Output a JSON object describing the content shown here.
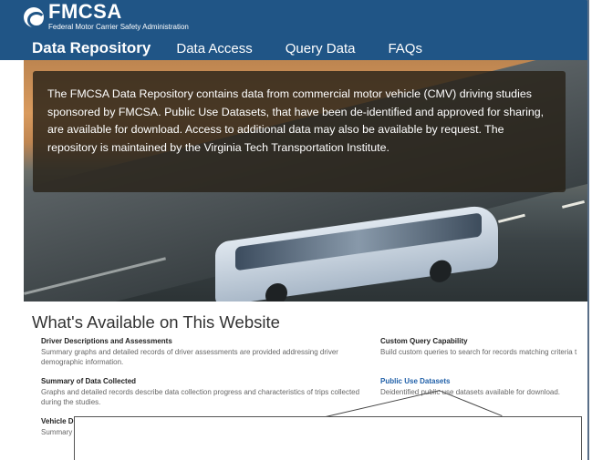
{
  "header": {
    "logo_title": "FMCSA",
    "logo_subtitle": "Federal Motor Carrier Safety Administration",
    "logo_icon": "fmcsa-logo-icon"
  },
  "nav": {
    "items": [
      {
        "label": "Data Repository",
        "active": true
      },
      {
        "label": "Data Access",
        "active": false
      },
      {
        "label": "Query Data",
        "active": false
      },
      {
        "label": "FAQs",
        "active": false
      }
    ]
  },
  "hero": {
    "intro": "The FMCSA Data Repository contains data from commercial motor vehicle (CMV) driving studies sponsored by FMCSA. Public Use Datasets, that have been de-identified and approved for sharing, are available for download. Access to additional data may also be available by request. The repository is maintained by the Virginia Tech Transportation Institute."
  },
  "main": {
    "section_title": "What's Available on This Website",
    "left_features": [
      {
        "title": "Driver Descriptions and Assessments",
        "desc": "Summary graphs and detailed records of driver assessments are provided addressing driver demographic information."
      },
      {
        "title": "Summary of Data Collected",
        "desc": "Graphs and detailed records describe data collection progress and characteristics of trips collected during the studies."
      },
      {
        "title": "Vehicle D",
        "desc": "Summary"
      }
    ],
    "right_features": [
      {
        "title": "Custom Query Capability",
        "desc": "Build custom queries to search for records matching criteria t"
      },
      {
        "title": "Public Use Datasets",
        "desc": "Deidentified public use datasets available for download."
      }
    ]
  },
  "colors": {
    "header_bg": "#205586",
    "link": "#1f5fa8"
  }
}
